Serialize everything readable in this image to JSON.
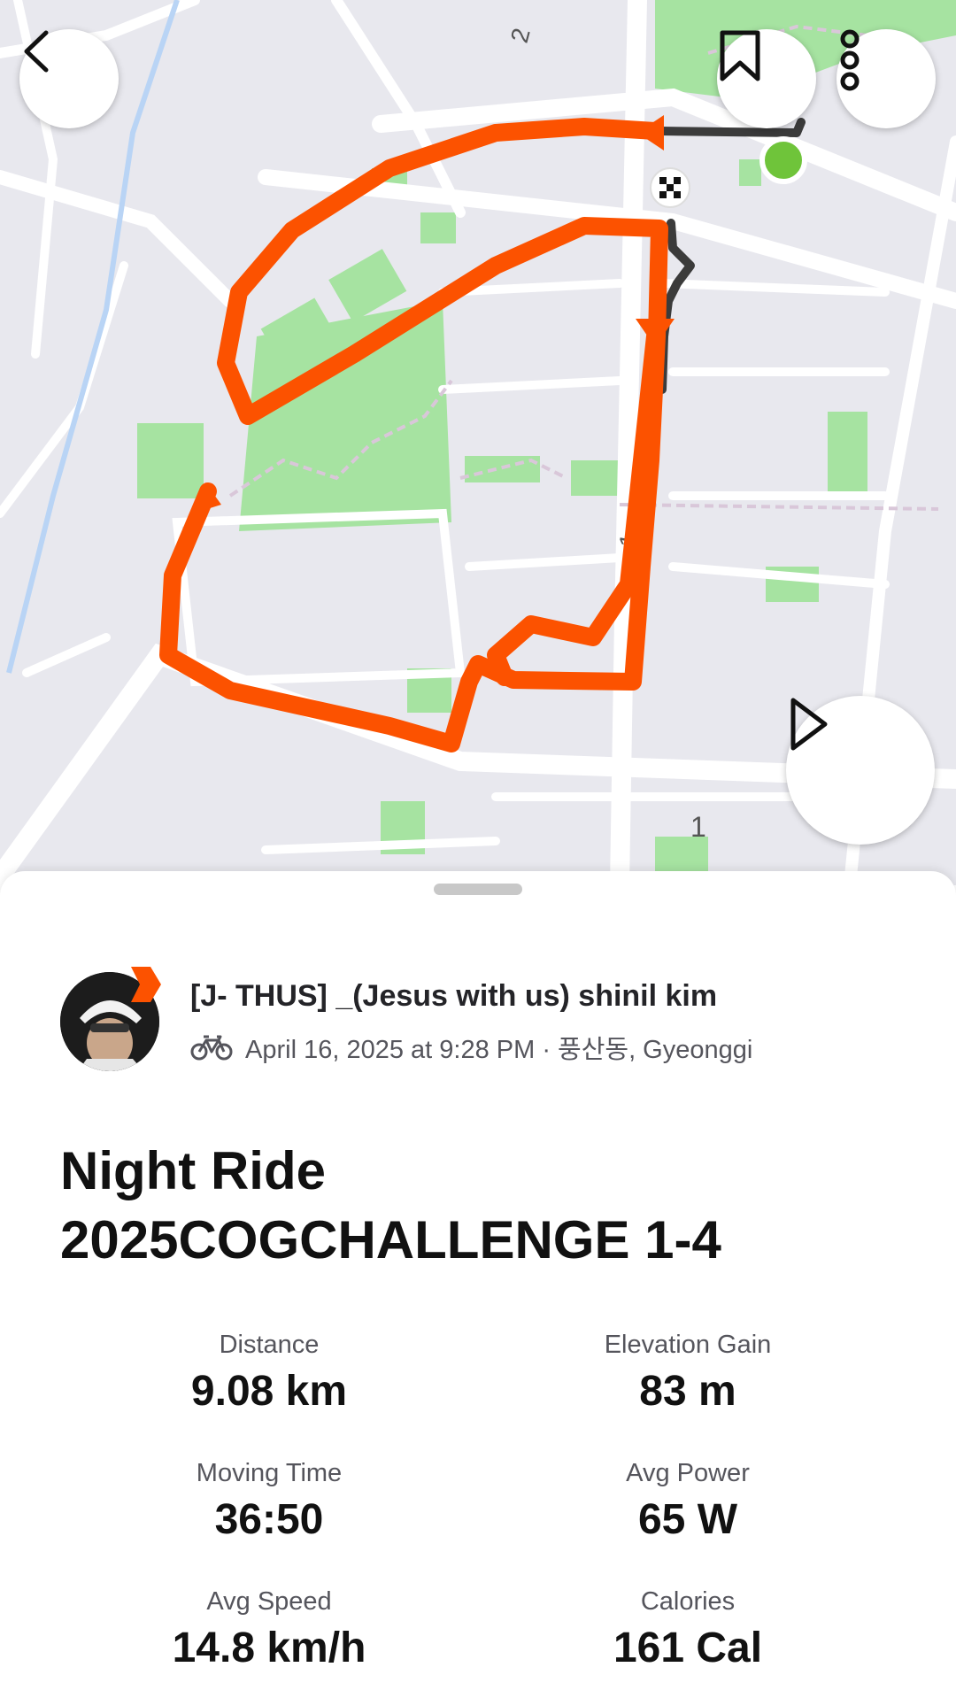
{
  "map": {
    "route_color": "#fc5200",
    "start_color": "#6fc43a",
    "labels": [
      "2",
      "1",
      "1"
    ]
  },
  "toolbar": {
    "back_icon": "chevron-left-icon",
    "bookmark_icon": "bookmark-icon",
    "more_icon": "more-vertical-icon",
    "play_icon": "play-icon"
  },
  "activity": {
    "athlete_name": "[J- THUS] _(Jesus with us) shinil kim",
    "sport_icon": "bike-icon",
    "date_location": "April 16, 2025 at 9:28 PM · 풍산동, Gyeonggi",
    "title_line1": "Night Ride",
    "title_line2": "2025COGCHALLENGE 1-4"
  },
  "stats": [
    {
      "label": "Distance",
      "value": "9.08 km"
    },
    {
      "label": "Elevation Gain",
      "value": "83 m"
    },
    {
      "label": "Moving Time",
      "value": "36:50"
    },
    {
      "label": "Avg Power",
      "value": "65 W"
    },
    {
      "label": "Avg Speed",
      "value": "14.8 km/h"
    },
    {
      "label": "Calories",
      "value": "161 Cal"
    }
  ]
}
